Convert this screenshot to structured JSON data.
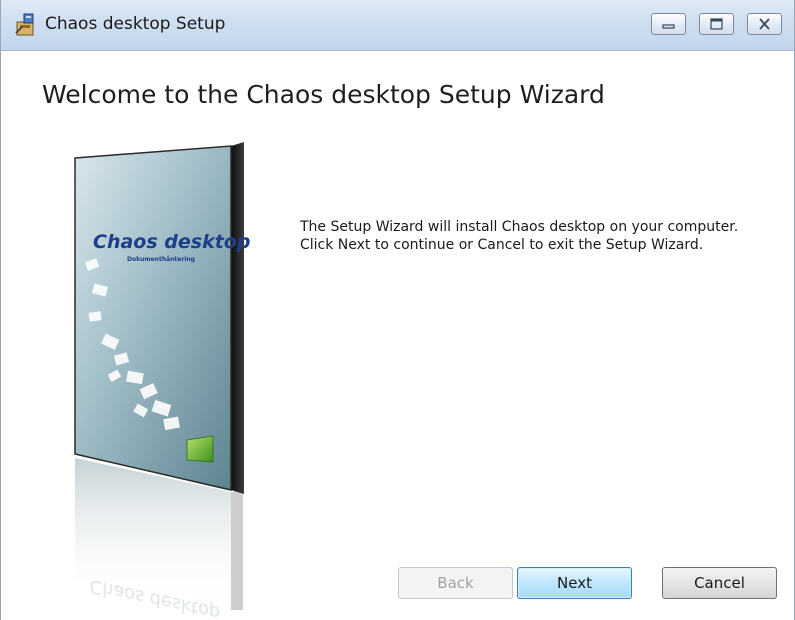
{
  "window": {
    "title": "Chaos desktop Setup",
    "controls": {
      "minimize": "minimize",
      "maximize": "maximize",
      "close": "close"
    }
  },
  "main": {
    "heading": "Welcome to the Chaos desktop Setup Wizard",
    "description": "The Setup Wizard will install Chaos desktop on your computer. Click Next to continue or Cancel to exit the Setup Wizard."
  },
  "product_box": {
    "logo_text": "Chaos desktop",
    "tagline": "Dokumenthåntering",
    "reflection_text": "Chaos desktop"
  },
  "buttons": {
    "back": "Back",
    "next": "Next",
    "cancel": "Cancel"
  },
  "colors": {
    "titlebar": "#cfdff0",
    "next_button_border": "#3c7fb1",
    "disabled_text": "#a3a3a3"
  }
}
